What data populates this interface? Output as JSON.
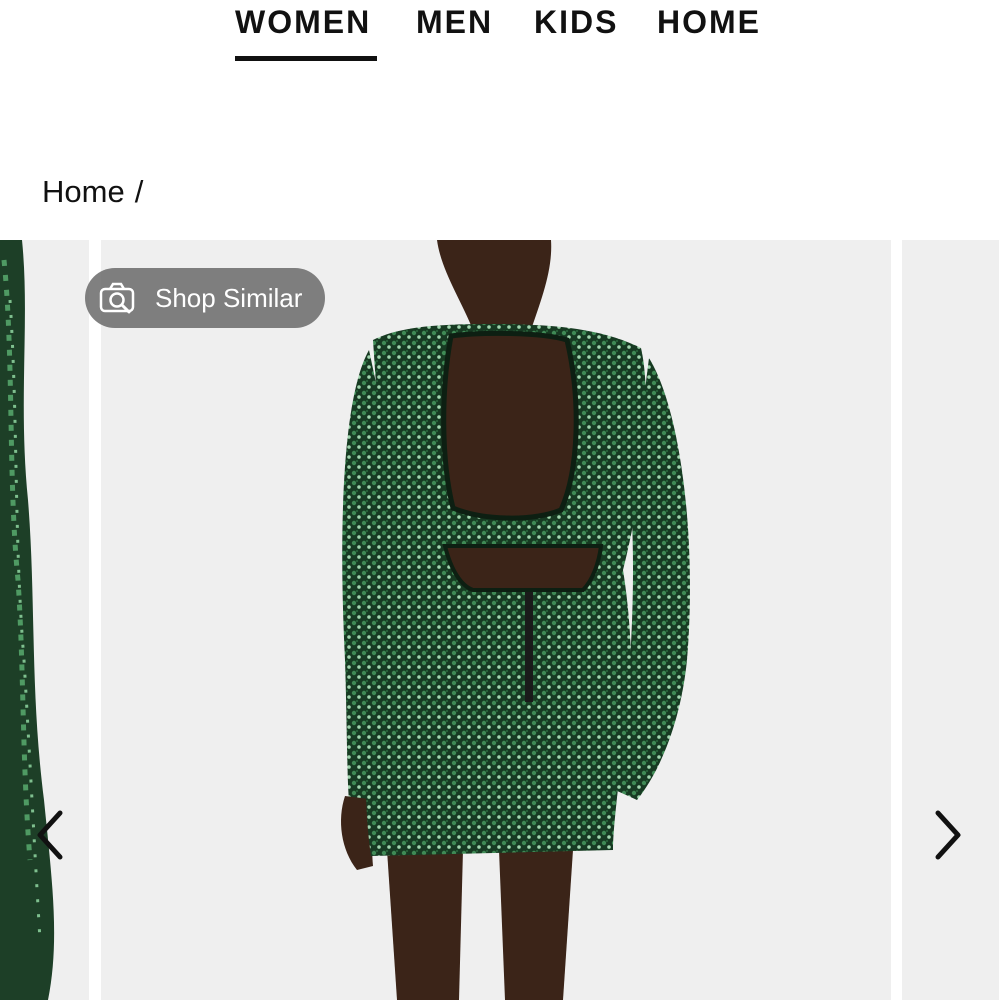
{
  "nav": {
    "items": [
      {
        "label": "WOMEN",
        "active": true
      },
      {
        "label": "MEN",
        "active": false
      },
      {
        "label": "KIDS",
        "active": false
      },
      {
        "label": "HOME",
        "active": false
      }
    ]
  },
  "breadcrumb": {
    "home_label": "Home",
    "separator": "/"
  },
  "carousel": {
    "shop_similar_label": "Shop Similar",
    "shop_similar_icon": "camera-search-icon",
    "prev_icon": "chevron-left-icon",
    "next_icon": "chevron-right-icon",
    "slide_background": "#efefef",
    "product_color": "#1f4a2c"
  }
}
